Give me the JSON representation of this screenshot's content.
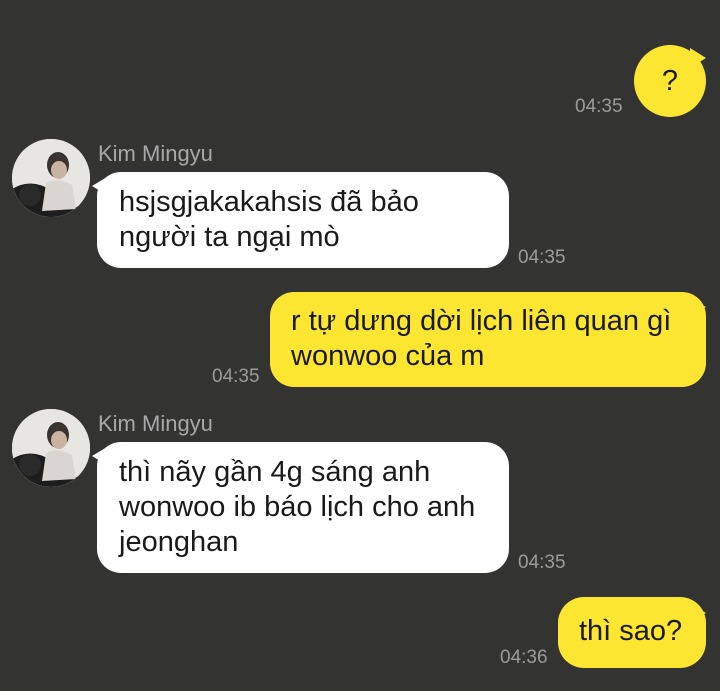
{
  "contact": {
    "name": "Kim Mingyu",
    "avatar_icon": "profile-photo-icon"
  },
  "colors": {
    "background": "#333432",
    "outgoing_bubble": "#fde631",
    "incoming_bubble": "#ffffff",
    "timestamp": "#9b9b9b"
  },
  "messages": [
    {
      "direction": "out",
      "text": "?",
      "time": "04:35"
    },
    {
      "direction": "in",
      "sender": "Kim Mingyu",
      "text": "hsjsgjakakahsis đã bảo\nngười ta ngại mò",
      "time": "04:35"
    },
    {
      "direction": "out",
      "text": "r tự dưng dời lịch liên quan gì\nwonwoo của m",
      "time": "04:35"
    },
    {
      "direction": "in",
      "sender": "Kim Mingyu",
      "text": "thì nãy gần 4g sáng anh\nwonwoo ib báo lịch cho anh\njeonghan",
      "time": "04:35"
    },
    {
      "direction": "out",
      "text": "thì sao?",
      "time": "04:36"
    }
  ]
}
